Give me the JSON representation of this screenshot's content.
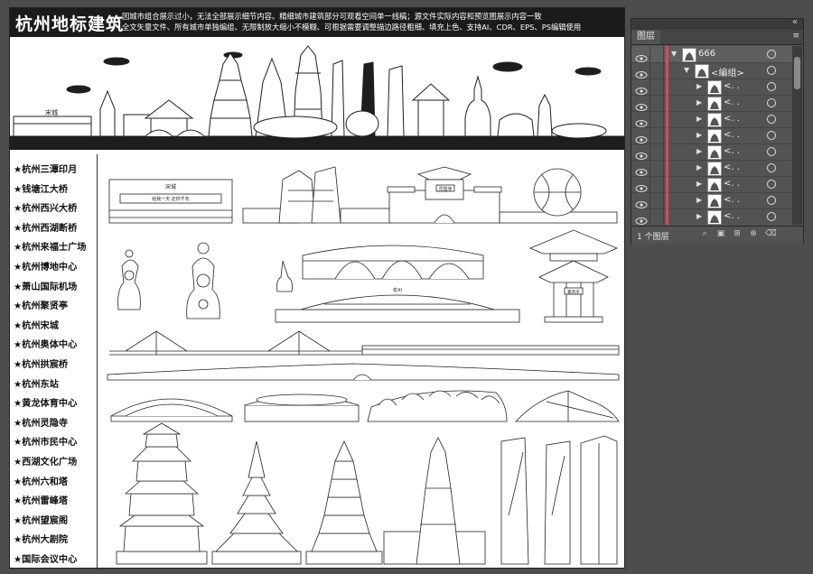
{
  "document": {
    "title": "杭州地标建筑",
    "description_lines": [
      "因城市组合展示过小，无法全部展示细节内容。精细城市建筑部分可观看空间单一线稿；源文件实际内容和预览图展示内容一致",
      "全文矢量文件、所有城市单独编组、无限制放大缩小不模糊、可根据需要调整描边路径粗细、填充上色、支持AI、CDR、EPS、PS编辑使用"
    ],
    "landmark_names": [
      "★杭州三潭印月",
      "★钱塘江大桥",
      "★杭州西兴大桥",
      "★杭州西湖断桥",
      "★杭州来福士广场",
      "★杭州博地中心",
      "★萧山国际机场",
      "★杭州聚贤亭",
      "★杭州宋城",
      "★杭州奥体中心",
      "★杭州拱宸桥",
      "★杭州东站",
      "★黄龙体育中心",
      "★杭州灵隐寺",
      "★杭州市民中心",
      "★西湖文化广场",
      "★杭州六和塔",
      "★杭州雷峰塔",
      "★杭州望宸阁",
      "★杭州大剧院",
      "★国际会议中心"
    ],
    "drawing_texts": {
      "song_city": "宋城",
      "song_city_banner": "给我一天 还你千年",
      "gate_plaque": "灵隐寺",
      "station_sign": "杭州",
      "pavilion_plaque": "聚贤亭"
    }
  },
  "layers_panel": {
    "tab_label": "图层",
    "collapse_symbol": "«",
    "close_symbol": "×",
    "menu_symbol": "≡",
    "layer_count": "1 个图层",
    "rows": [
      {
        "name": "666",
        "level": 0,
        "expanded": true
      },
      {
        "name": "<编组>",
        "level": 1,
        "expanded": true
      },
      {
        "name": "<. .",
        "level": 2,
        "expanded": false
      },
      {
        "name": "<. .",
        "level": 2,
        "expanded": false
      },
      {
        "name": "<. .",
        "level": 2,
        "expanded": false
      },
      {
        "name": "<. .",
        "level": 2,
        "expanded": false
      },
      {
        "name": "<. .",
        "level": 2,
        "expanded": false
      },
      {
        "name": "<. .",
        "level": 2,
        "expanded": false
      },
      {
        "name": "<. .",
        "level": 2,
        "expanded": false
      },
      {
        "name": "<. .",
        "level": 2,
        "expanded": false
      },
      {
        "name": "<. .",
        "level": 2,
        "expanded": false
      }
    ],
    "colors": {
      "layer_color": "#d94a5a",
      "panel_bg": "#535353"
    }
  }
}
